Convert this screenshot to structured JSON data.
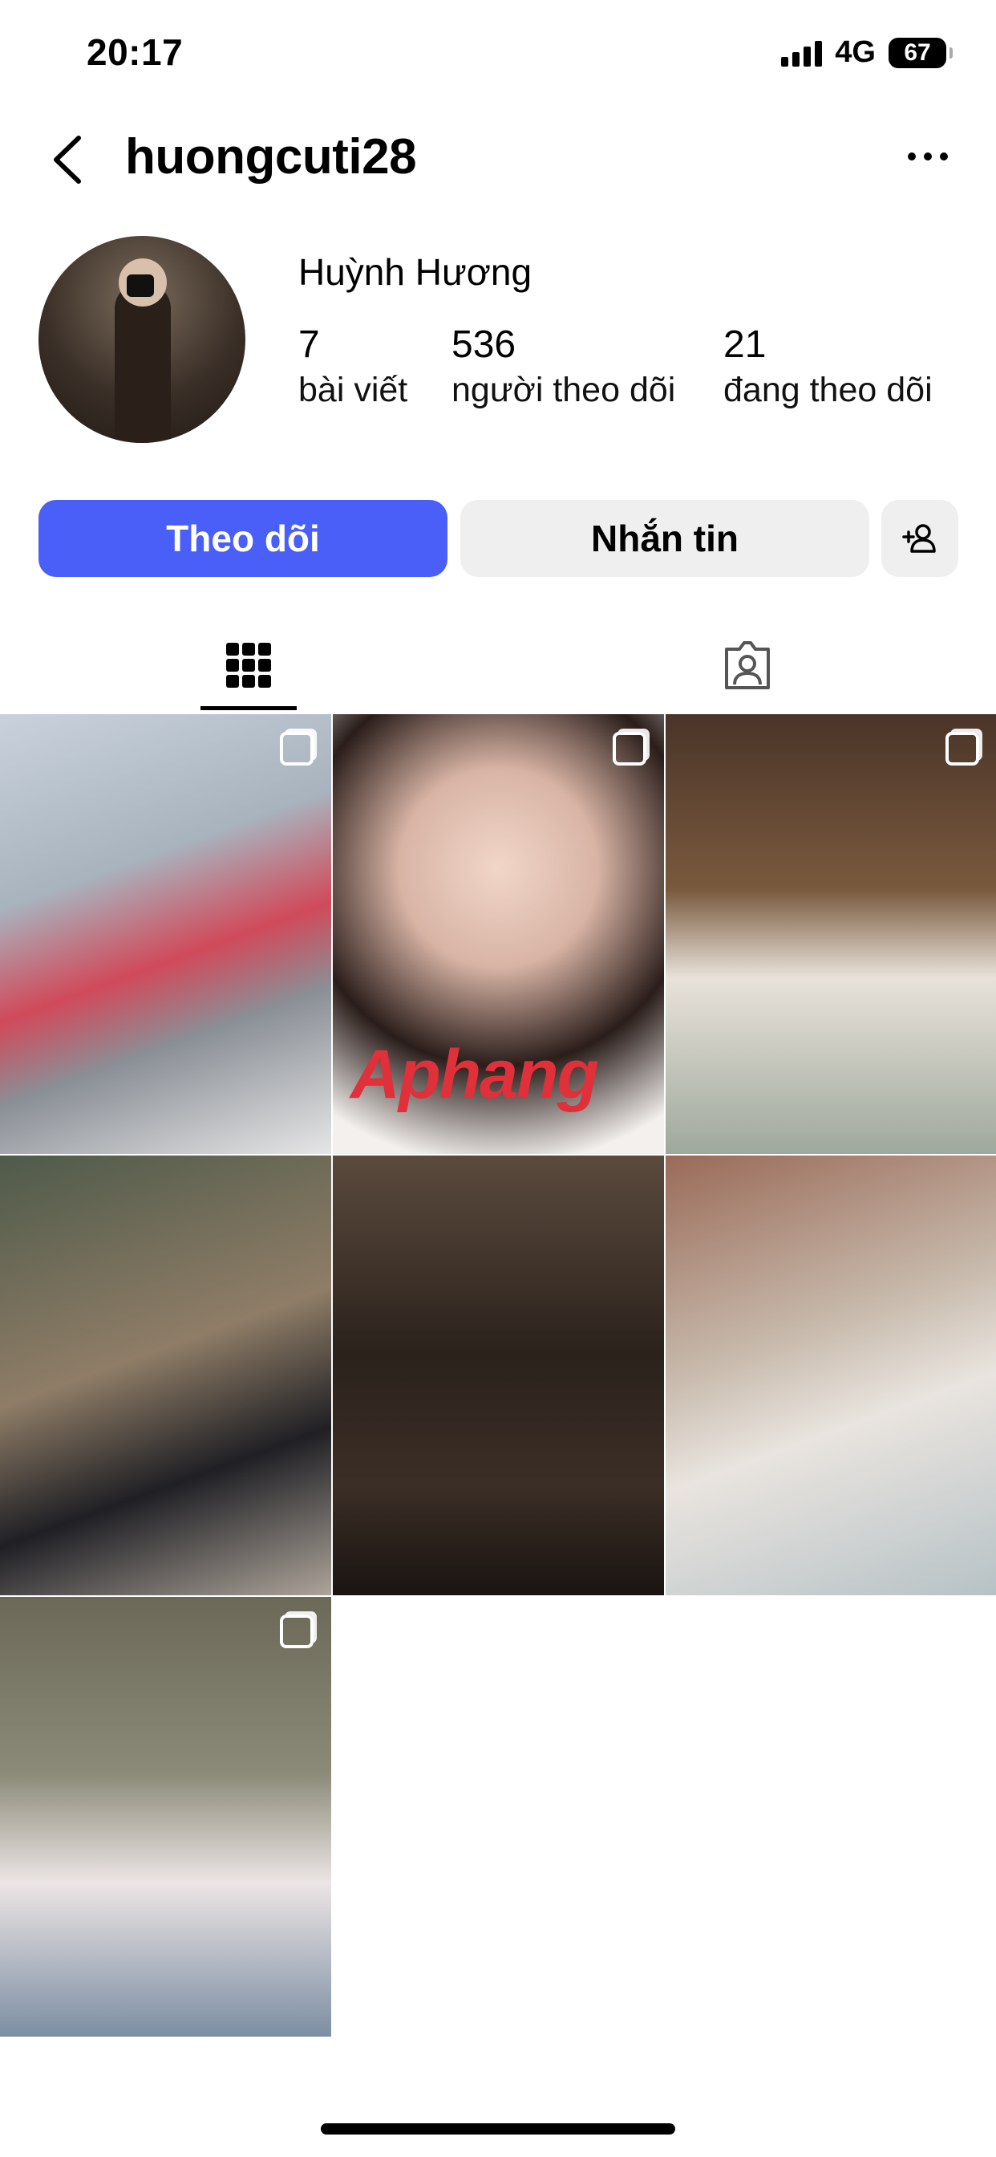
{
  "status_bar": {
    "time": "20:17",
    "network": "4G",
    "battery": "67"
  },
  "header": {
    "username": "huongcuti28"
  },
  "profile": {
    "full_name": "Huỳnh Hương",
    "stats": [
      {
        "value": "7",
        "label": "bài viết"
      },
      {
        "value": "536",
        "label": "người theo dõi"
      },
      {
        "value": "21",
        "label": "đang theo dõi"
      }
    ]
  },
  "actions": {
    "follow": "Theo dõi",
    "message": "Nhắn tin"
  },
  "tabs": {
    "active": "grid",
    "items": [
      "grid-icon",
      "tagged-icon"
    ]
  },
  "posts": [
    {
      "multi": true
    },
    {
      "multi": true,
      "watermark": "Aphang"
    },
    {
      "multi": true
    },
    {
      "multi": false
    },
    {
      "multi": false
    },
    {
      "multi": false
    },
    {
      "multi": true
    }
  ],
  "colors": {
    "accent": "#4a5ff7",
    "button_secondary": "#efefef"
  }
}
